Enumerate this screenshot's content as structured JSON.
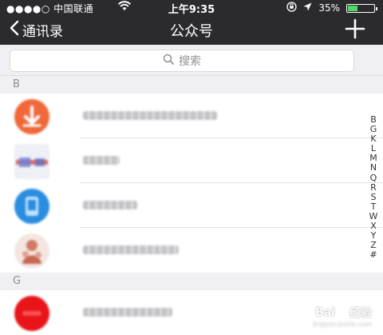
{
  "status_bar": {
    "carrier": "●●●●○ 中国联通",
    "time": "上午9:35",
    "battery": "35%",
    "battery_level": 0.35
  },
  "nav": {
    "back_label": "通讯录",
    "title": "公众号",
    "add_icon": "plus-icon"
  },
  "search": {
    "placeholder": "搜索",
    "icon": "search-icon"
  },
  "sections": [
    {
      "letter": "B",
      "items": [
        {
          "avatar_color": "#f0683a"
        },
        {
          "avatar_color": "#c9d0e8"
        },
        {
          "avatar_color": "#2a8de0"
        },
        {
          "avatar_color": "#d99a8c"
        }
      ]
    },
    {
      "letter": "G",
      "items": [
        {
          "avatar_color": "#e8141a"
        }
      ]
    }
  ],
  "index_letters": [
    "B",
    "G",
    "K",
    "L",
    "M",
    "N",
    "Q",
    "R",
    "S",
    "T",
    "W",
    "X",
    "Y",
    "Z",
    "#"
  ],
  "watermark": {
    "brand": "Bai",
    "brand2": "经验",
    "url": "jingyan.baidu.com"
  }
}
